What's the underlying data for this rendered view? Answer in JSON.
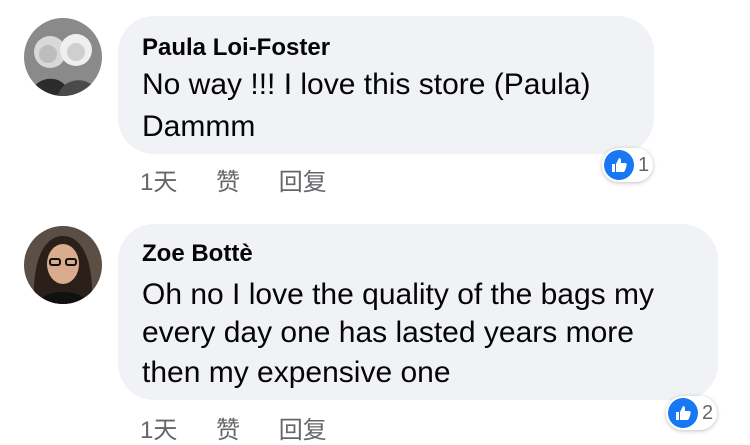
{
  "comments": [
    {
      "author": "Paula Loi-Foster",
      "lines": [
        "No way !!!  I love this store (Paula)",
        "Dammm"
      ],
      "time": "1天",
      "like_label": "赞",
      "reply_label": "回复",
      "reactions": "1"
    },
    {
      "author": "Zoe Bottè",
      "lines": [
        "Oh no I love the quality of the bags my",
        "every day one has lasted years more",
        "then my expensive one"
      ],
      "time": "1天",
      "like_label": "赞",
      "reply_label": "回复",
      "reactions": "2"
    }
  ],
  "colors": {
    "bubble": "#f0f2f5",
    "text": "#050505",
    "meta": "#65676b",
    "like": "#1877f2"
  }
}
